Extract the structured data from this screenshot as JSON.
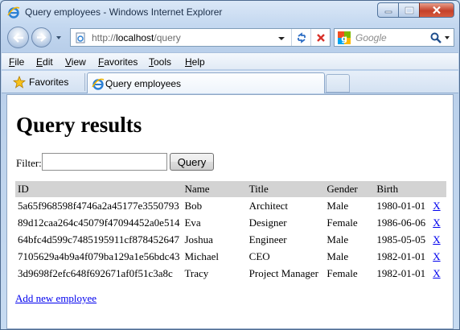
{
  "window": {
    "title": "Query employees - Windows Internet Explorer"
  },
  "address_bar": {
    "url_prefix": "http://",
    "url_host": "localhost",
    "url_path": "/query"
  },
  "search": {
    "placeholder": "Google"
  },
  "menu": {
    "items": [
      "File",
      "Edit",
      "View",
      "Favorites",
      "Tools",
      "Help"
    ]
  },
  "favorites_bar": {
    "label": "Favorites"
  },
  "tab": {
    "label": "Query employees"
  },
  "page": {
    "heading": "Query results",
    "filter_label": "Filter:",
    "filter_value": "",
    "query_button": "Query",
    "table": {
      "columns": [
        "ID",
        "Name",
        "Title",
        "Gender",
        "Birth",
        ""
      ],
      "rows": [
        [
          "5a65f968598f4746a2a45177e3550793",
          "Bob",
          "Architect",
          "Male",
          "1980-01-01",
          "X"
        ],
        [
          "89d12caa264c45079f47094452a0e514",
          "Eva",
          "Designer",
          "Female",
          "1986-06-06",
          "X"
        ],
        [
          "64bfc4d599c7485195911cf878452647",
          "Joshua",
          "Engineer",
          "Male",
          "1985-05-05",
          "X"
        ],
        [
          "7105629a4b9a4f079ba129a1e56bdc43",
          "Michael",
          "CEO",
          "Male",
          "1982-01-01",
          "X"
        ],
        [
          "3d9698f2efc648f692671af0f51c3a8c",
          "Tracy",
          "Project Manager",
          "Female",
          "1982-01-01",
          "X"
        ]
      ]
    },
    "add_link": "Add new employee"
  },
  "colors": {
    "link": "#0000ee",
    "table_header_bg": "#d3d3d3"
  }
}
